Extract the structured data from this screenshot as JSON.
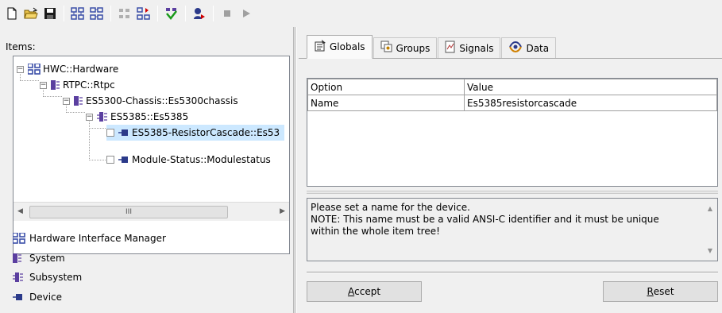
{
  "toolbar": {
    "buttons": [
      {
        "icon": "new-file-icon"
      },
      {
        "icon": "open-folder-icon"
      },
      {
        "icon": "save-icon"
      },
      {
        "icon": "add-node-icon"
      },
      {
        "icon": "add-child-node-icon"
      },
      {
        "icon": "move-node-icon"
      },
      {
        "icon": "move-node-red-icon"
      },
      {
        "icon": "build-icon"
      },
      {
        "icon": "run-user-icon"
      },
      {
        "icon": "stop-icon"
      },
      {
        "icon": "play-icon"
      }
    ]
  },
  "items_label": "Items:",
  "tree": [
    {
      "label": "HWC::Hardware",
      "level": 0,
      "expander": "−",
      "icon": "hardware-icon"
    },
    {
      "label": "RTPC::Rtpc",
      "level": 1,
      "expander": "−",
      "icon": "system-icon"
    },
    {
      "label": "ES5300-Chassis::Es5300chassis",
      "level": 2,
      "expander": "−",
      "icon": "system-icon"
    },
    {
      "label": "ES5385::Es5385",
      "level": 3,
      "expander": "−",
      "icon": "subsystem-icon"
    },
    {
      "label": "ES5385-ResistorCascade::Es53",
      "level": 4,
      "icon": "device-icon",
      "checkbox": true
    },
    {
      "label": "Module-Status::Modulestatus",
      "level": 4,
      "icon": "device-icon",
      "checkbox": true
    }
  ],
  "scroll_thumb_grip": "III",
  "legend": [
    {
      "label": "Hardware Interface Manager",
      "icon": "hardware-icon"
    },
    {
      "label": "System",
      "icon": "system-icon"
    },
    {
      "label": "Subsystem",
      "icon": "subsystem-icon"
    },
    {
      "label": "Device",
      "icon": "device-icon"
    }
  ],
  "tabs": [
    {
      "label": "Globals",
      "icon": "globals-icon",
      "active": true
    },
    {
      "label": "Groups",
      "icon": "groups-icon",
      "active": false
    },
    {
      "label": "Signals",
      "icon": "signals-icon",
      "active": false
    },
    {
      "label": "Data",
      "icon": "data-icon",
      "active": false
    }
  ],
  "grid": {
    "headers": [
      "Option",
      "Value"
    ],
    "rows": [
      [
        "Name",
        "Es5385resistorcascade"
      ]
    ]
  },
  "description": {
    "line1": "Please set a name for the device.",
    "line2": "NOTE: This name must be a valid ANSI-C identifier and it must be unique",
    "line3": "within the whole item tree!"
  },
  "buttons": {
    "accept_underlined": "A",
    "accept_rest": "ccept",
    "reset_underlined": "R",
    "reset_rest": "eset"
  },
  "colors": {
    "selection": "#cce8ff",
    "icon_blue": "#3b4fa8",
    "icon_purple": "#5b3fa0"
  }
}
